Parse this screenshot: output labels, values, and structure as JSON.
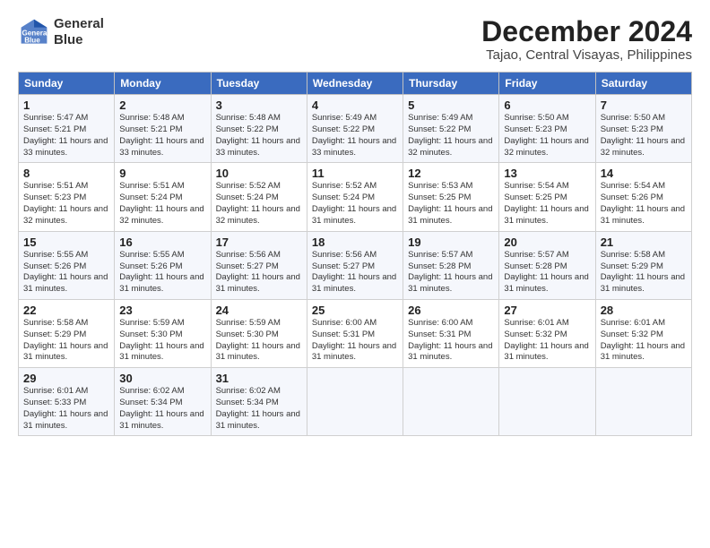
{
  "header": {
    "logo_line1": "General",
    "logo_line2": "Blue",
    "title": "December 2024",
    "subtitle": "Tajao, Central Visayas, Philippines"
  },
  "days_of_week": [
    "Sunday",
    "Monday",
    "Tuesday",
    "Wednesday",
    "Thursday",
    "Friday",
    "Saturday"
  ],
  "weeks": [
    [
      {
        "day": "1",
        "sunrise": "5:47 AM",
        "sunset": "5:21 PM",
        "daylight": "11 hours and 33 minutes."
      },
      {
        "day": "2",
        "sunrise": "5:48 AM",
        "sunset": "5:21 PM",
        "daylight": "11 hours and 33 minutes."
      },
      {
        "day": "3",
        "sunrise": "5:48 AM",
        "sunset": "5:22 PM",
        "daylight": "11 hours and 33 minutes."
      },
      {
        "day": "4",
        "sunrise": "5:49 AM",
        "sunset": "5:22 PM",
        "daylight": "11 hours and 33 minutes."
      },
      {
        "day": "5",
        "sunrise": "5:49 AM",
        "sunset": "5:22 PM",
        "daylight": "11 hours and 32 minutes."
      },
      {
        "day": "6",
        "sunrise": "5:50 AM",
        "sunset": "5:23 PM",
        "daylight": "11 hours and 32 minutes."
      },
      {
        "day": "7",
        "sunrise": "5:50 AM",
        "sunset": "5:23 PM",
        "daylight": "11 hours and 32 minutes."
      }
    ],
    [
      {
        "day": "8",
        "sunrise": "5:51 AM",
        "sunset": "5:23 PM",
        "daylight": "11 hours and 32 minutes."
      },
      {
        "day": "9",
        "sunrise": "5:51 AM",
        "sunset": "5:24 PM",
        "daylight": "11 hours and 32 minutes."
      },
      {
        "day": "10",
        "sunrise": "5:52 AM",
        "sunset": "5:24 PM",
        "daylight": "11 hours and 32 minutes."
      },
      {
        "day": "11",
        "sunrise": "5:52 AM",
        "sunset": "5:24 PM",
        "daylight": "11 hours and 31 minutes."
      },
      {
        "day": "12",
        "sunrise": "5:53 AM",
        "sunset": "5:25 PM",
        "daylight": "11 hours and 31 minutes."
      },
      {
        "day": "13",
        "sunrise": "5:54 AM",
        "sunset": "5:25 PM",
        "daylight": "11 hours and 31 minutes."
      },
      {
        "day": "14",
        "sunrise": "5:54 AM",
        "sunset": "5:26 PM",
        "daylight": "11 hours and 31 minutes."
      }
    ],
    [
      {
        "day": "15",
        "sunrise": "5:55 AM",
        "sunset": "5:26 PM",
        "daylight": "11 hours and 31 minutes."
      },
      {
        "day": "16",
        "sunrise": "5:55 AM",
        "sunset": "5:26 PM",
        "daylight": "11 hours and 31 minutes."
      },
      {
        "day": "17",
        "sunrise": "5:56 AM",
        "sunset": "5:27 PM",
        "daylight": "11 hours and 31 minutes."
      },
      {
        "day": "18",
        "sunrise": "5:56 AM",
        "sunset": "5:27 PM",
        "daylight": "11 hours and 31 minutes."
      },
      {
        "day": "19",
        "sunrise": "5:57 AM",
        "sunset": "5:28 PM",
        "daylight": "11 hours and 31 minutes."
      },
      {
        "day": "20",
        "sunrise": "5:57 AM",
        "sunset": "5:28 PM",
        "daylight": "11 hours and 31 minutes."
      },
      {
        "day": "21",
        "sunrise": "5:58 AM",
        "sunset": "5:29 PM",
        "daylight": "11 hours and 31 minutes."
      }
    ],
    [
      {
        "day": "22",
        "sunrise": "5:58 AM",
        "sunset": "5:29 PM",
        "daylight": "11 hours and 31 minutes."
      },
      {
        "day": "23",
        "sunrise": "5:59 AM",
        "sunset": "5:30 PM",
        "daylight": "11 hours and 31 minutes."
      },
      {
        "day": "24",
        "sunrise": "5:59 AM",
        "sunset": "5:30 PM",
        "daylight": "11 hours and 31 minutes."
      },
      {
        "day": "25",
        "sunrise": "6:00 AM",
        "sunset": "5:31 PM",
        "daylight": "11 hours and 31 minutes."
      },
      {
        "day": "26",
        "sunrise": "6:00 AM",
        "sunset": "5:31 PM",
        "daylight": "11 hours and 31 minutes."
      },
      {
        "day": "27",
        "sunrise": "6:01 AM",
        "sunset": "5:32 PM",
        "daylight": "11 hours and 31 minutes."
      },
      {
        "day": "28",
        "sunrise": "6:01 AM",
        "sunset": "5:32 PM",
        "daylight": "11 hours and 31 minutes."
      }
    ],
    [
      {
        "day": "29",
        "sunrise": "6:01 AM",
        "sunset": "5:33 PM",
        "daylight": "11 hours and 31 minutes."
      },
      {
        "day": "30",
        "sunrise": "6:02 AM",
        "sunset": "5:34 PM",
        "daylight": "11 hours and 31 minutes."
      },
      {
        "day": "31",
        "sunrise": "6:02 AM",
        "sunset": "5:34 PM",
        "daylight": "11 hours and 31 minutes."
      },
      null,
      null,
      null,
      null
    ]
  ]
}
